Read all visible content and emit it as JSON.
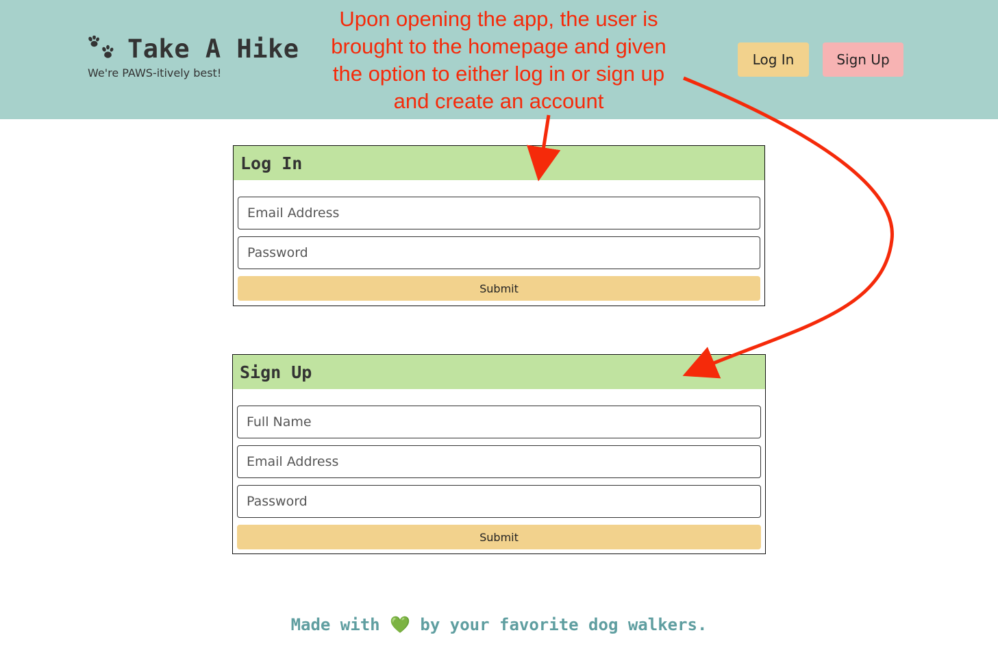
{
  "header": {
    "title": "Take A Hike",
    "tagline": "We're PAWS-itively best!",
    "nav": {
      "login_label": "Log In",
      "signup_label": "Sign Up"
    },
    "icons": {
      "logo": "paw-prints-icon"
    }
  },
  "annotation": {
    "text": "Upon opening the app, the user is brought to the homepage and given the option to either log in or sign up and create an account"
  },
  "login_form": {
    "title": "Log In",
    "email_placeholder": "Email Address",
    "password_placeholder": "Password",
    "submit_label": "Submit"
  },
  "signup_form": {
    "title": "Sign Up",
    "name_placeholder": "Full Name",
    "email_placeholder": "Email Address",
    "password_placeholder": "Password",
    "submit_label": "Submit"
  },
  "footer": {
    "prefix": "Made with",
    "heart": "💚",
    "suffix": "by your favorite dog walkers."
  },
  "colors": {
    "header_bg": "#a7d1cb",
    "card_header_bg": "#c0e3a0",
    "button_yellow": "#f2d28d",
    "button_pink": "#f7b3b3",
    "annotation_red": "#f52a0a",
    "footer_text": "#5f9ea0"
  }
}
